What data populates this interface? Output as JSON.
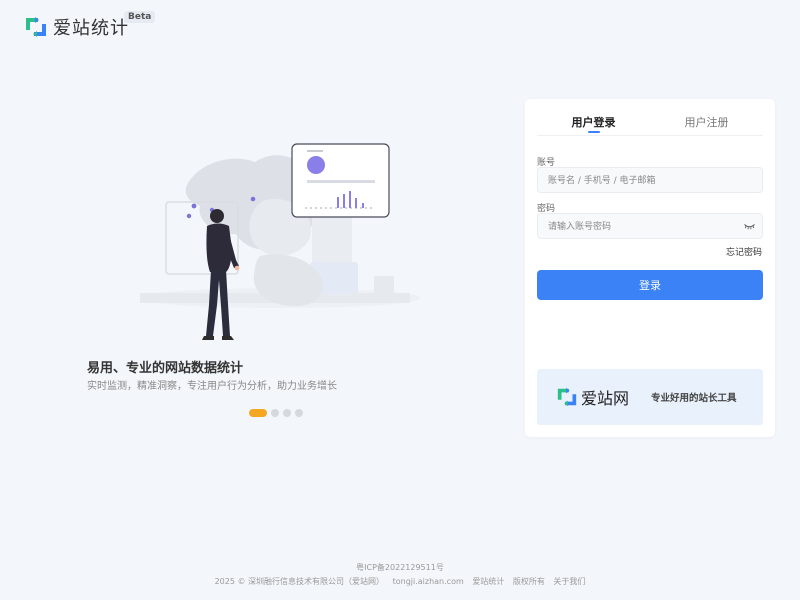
{
  "header": {
    "brand": "爱站统计",
    "badge": "Beta"
  },
  "hero": {
    "slogan": "易用、专业的网站数据统计",
    "subtitle": "实时监测，精准洞察，专注用户行为分析，助力业务增长",
    "carousel": {
      "count": 4,
      "active_index": 0
    }
  },
  "login": {
    "tabs": [
      {
        "label": "用户登录",
        "active": true
      },
      {
        "label": "用户注册",
        "active": false
      }
    ],
    "account_label": "账号",
    "account_placeholder": "账号名 / 手机号 / 电子邮箱",
    "password_label": "密码",
    "password_placeholder": "请输入账号密码",
    "forgot": "忘记密码",
    "submit": "登录"
  },
  "banner": {
    "name": "爱站网",
    "tagline": "专业好用的站长工具"
  },
  "footer": {
    "icp": "粤ICP备2022129511号",
    "copyright": "2025 © 深圳融行信息技术有限公司（爱站网）",
    "links": [
      "tongji.aizhan.com",
      "爱站统计",
      "版权所有",
      "关于我们"
    ]
  },
  "colors": {
    "primary": "#3b82f6",
    "carousel_active": "#f5a623",
    "logo_green": "#2bbf8a",
    "logo_blue": "#3b82f6"
  }
}
